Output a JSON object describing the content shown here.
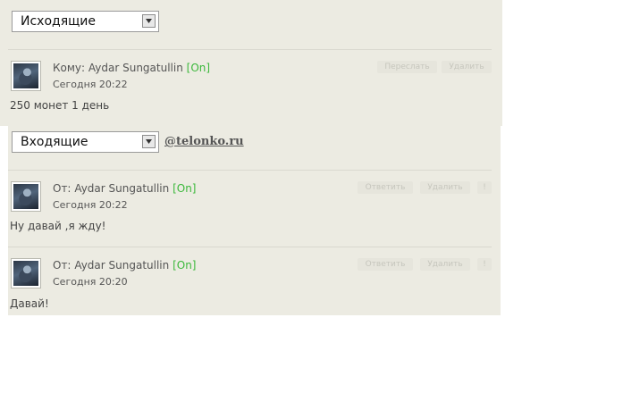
{
  "outgoing": {
    "filter_value": "Исходящие",
    "messages": [
      {
        "prefix": "Кому:",
        "name": "Aydar Sungatullin",
        "status": "[On]",
        "time": "Сегодня 20:22",
        "text": "250 монет 1 день",
        "actions": [
          "Переслать",
          "Удалить"
        ]
      }
    ]
  },
  "incoming": {
    "filter_value": "Входящие",
    "site": "@telonko.ru",
    "messages": [
      {
        "prefix": "От:",
        "name": "Aydar Sungatullin",
        "status": "[On]",
        "time": "Сегодня 20:22",
        "text": "Ну давай ,я жду!",
        "actions": [
          "Ответить",
          "Удалить",
          "!"
        ]
      },
      {
        "prefix": "От:",
        "name": "Aydar Sungatullin",
        "status": "[On]",
        "time": "Сегодня 20:20",
        "text": "Давай!",
        "actions": [
          "Ответить",
          "Удалить",
          "!"
        ]
      }
    ]
  },
  "colors": {
    "panel_bg": "#ecebe2",
    "online_status": "#3bb83b",
    "action_text": "#c6c6bd"
  },
  "icons": {
    "dropdown": "chevron-down-icon",
    "avatar": "user-avatar"
  }
}
